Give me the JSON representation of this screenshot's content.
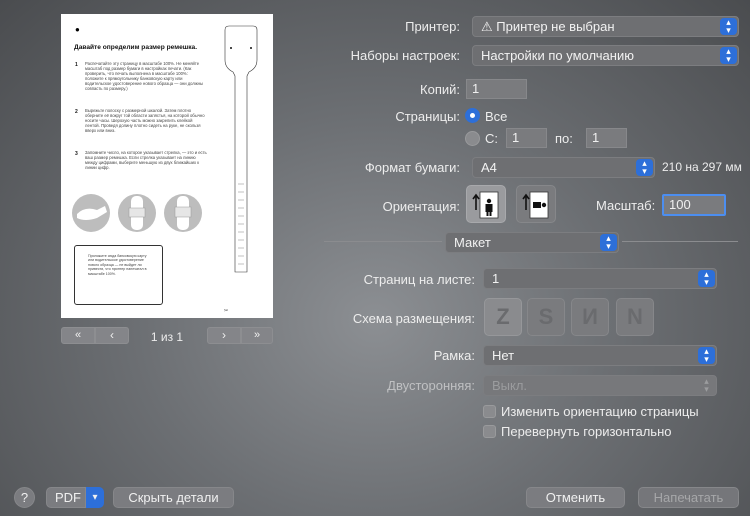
{
  "preview": {
    "title": "Давайте определим размер ремешка.",
    "step1": "Распечатайте эту страницу в масштабе 100%. Не меняйте масштаб под размер бумаги в настройках печати. (Как проверить, что печать выполнена в масштабе 100%: положите к прямоугольнику банковскую карту или водительское удостоверение нового образца — они должны совпасть по размеру.)",
    "step2": "Вырежьте полоску с размерной шкалой. Затем плотно оберните её вокруг той области запястья, на которой обычно носите часы. Шерохую часть можно закрепить клейкой лентой. Проведя долину плотно сидеть на руке, не скользя вверх или вниз.",
    "step3": "Запомните число, на которое указывает стрелка, — это и есть ваш размер ремешка. Если стрелка указывает на линию между цифрами, выберите меньшую из двух ближайших к линии цифр.",
    "card_note": "Приложите сюда банковскую карту или водительское удостоверение нового образца — не выйдет ли привести, что принтер напечатал в масштабе 100%.",
    "nums": [
      "1",
      "2",
      "3"
    ],
    "page_counter": "1 из 1",
    "nav_first": "«",
    "nav_prev": "‹",
    "nav_next": "›",
    "nav_last": "»"
  },
  "form": {
    "printer_label": "Принтер:",
    "printer_value": "⚠ Принтер не выбран",
    "presets_label": "Наборы настроек:",
    "presets_value": "Настройки по умолчанию",
    "copies_label": "Копий:",
    "copies_value": "1",
    "pages_label": "Страницы:",
    "pages_all": "Все",
    "pages_from": "С:",
    "pages_from_value": "1",
    "pages_to": "по:",
    "pages_to_value": "1",
    "paper_label": "Формат бумаги:",
    "paper_value": "A4",
    "paper_size": "210 на 297 мм",
    "orientation_label": "Ориентация:",
    "scale_label": "Масштаб:",
    "scale_value": "100",
    "section_value": "Макет",
    "pages_per_sheet_label": "Страниц на листе:",
    "pages_per_sheet_value": "1",
    "layout_dir_label": "Схема размещения:",
    "layout_dirs": [
      "Z",
      "S",
      "И",
      "N"
    ],
    "border_label": "Рамка:",
    "border_value": "Нет",
    "duplex_label": "Двусторонняя:",
    "duplex_value": "Выкл.",
    "reverse_label": "Изменить ориентацию страницы",
    "flip_label": "Перевернуть горизонтально"
  },
  "bottom": {
    "help": "?",
    "pdf": "PDF",
    "hide_details": "Скрыть детали",
    "cancel": "Отменить",
    "print": "Напечатать"
  },
  "colors": {
    "accent": "#2d6fd9"
  }
}
